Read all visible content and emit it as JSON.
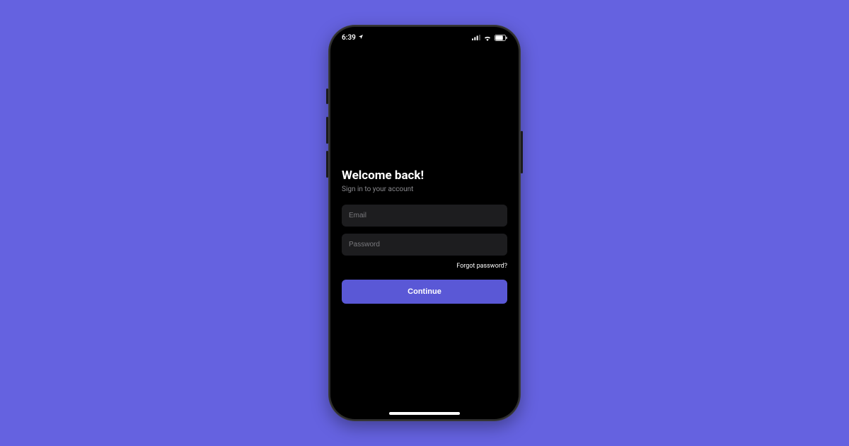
{
  "colors": {
    "page_bg": "#6562e0",
    "accent": "#5a58d6",
    "input_bg": "#1d1d1f"
  },
  "status": {
    "time": "6:39",
    "location_icon": "location-arrow-icon",
    "cellular_icon": "cellular-signal-icon",
    "wifi_icon": "wifi-icon",
    "battery_icon": "battery-icon"
  },
  "login": {
    "title": "Welcome back!",
    "subtitle": "Sign in to your account",
    "email_placeholder": "Email",
    "email_value": "",
    "password_placeholder": "Password",
    "password_value": "",
    "forgot_label": "Forgot password?",
    "continue_label": "Continue"
  }
}
